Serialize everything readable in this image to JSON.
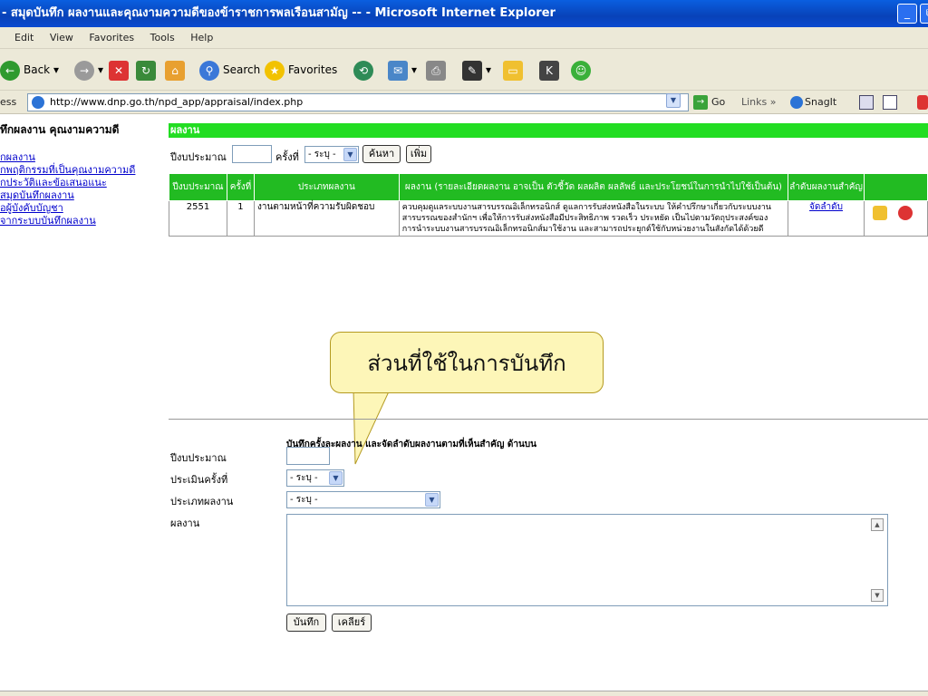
{
  "window": {
    "title": "- สมุดบันทึก ผลงานและคุณงามความดีของข้าราชการพลเรือนสามัญ -- - Microsoft Internet Explorer",
    "minimize": "_",
    "restore": "⧉"
  },
  "menu": [
    "Edit",
    "View",
    "Favorites",
    "Tools",
    "Help"
  ],
  "toolbar": {
    "back": "Back",
    "search": "Search",
    "favorites": "Favorites"
  },
  "address": {
    "label": "ess",
    "url": "http://www.dnp.go.th/npd_app/appraisal/index.php",
    "go": "Go",
    "links": "Links",
    "links_arrow": "»",
    "snagit": "SnagIt"
  },
  "sidebar": {
    "title": "ทึกผลงาน คุณงามความดี",
    "links": [
      "กผลงาน",
      "กพฤติกรรมที่เป็นคุณงามความดี",
      "กประวัติและข้อเสนอแนะ",
      "สมุดบันทึกผลงาน",
      "อผู้บังคับบัญชา",
      "จากระบบบันทึกผลงาน"
    ]
  },
  "section": {
    "title": "ผลงาน"
  },
  "search": {
    "year_label": "ปีงบประมาณ",
    "round_label": "ครั้งที่",
    "round_value": "- ระบุ -",
    "find_button": "ค้นหา",
    "add_button": "เพิ่ม"
  },
  "table": {
    "headers": [
      "ปีงบประมาณ",
      "ครั้งที่",
      "ประเภทผลงาน",
      "ผลงาน (รายละเอียดผลงาน อาจเป็น ตัวชี้วัด ผลผลิต ผลลัพธ์ และประโยชน์ในการนำไปใช้เป็นต้น)",
      "ลำดับผลงานสำคัญ",
      ""
    ],
    "rows": [
      {
        "year": "2551",
        "round": "1",
        "type": "งานตามหน้าที่ความรับผิดชอบ",
        "detail": "ควบคุมดูแลระบบงานสารบรรณอิเล็กทรอนิกส์ ดูแลการรับส่งหนังสือในระบบ ให้คำปรึกษาเกี่ยวกับระบบงานสารบรรณของสำนักฯ เพื่อให้การรับส่งหนังสือมีประสิทธิภาพ รวดเร็ว ประหยัด เป็นไปตามวัตถุประสงค์ของการนำระบบงานสารบรรณอิเล็กทรอนิกส์มาใช้งาน และสามารถประยุกต์ใช้กับหน่วยงานในสังกัดได้ด้วยดี",
        "rank": "จัดลำดับ"
      }
    ]
  },
  "callout": {
    "text": "ส่วนที่ใช้ในการบันทึก"
  },
  "form": {
    "heading": "บันทึกครั้งละผลงาน และจัดลำดับผลงานตามที่เห็นสำคัญ ด้านบน",
    "year_label": "ปีงบประมาณ",
    "round_label": "ประเมินครั้งที่",
    "round_value": "- ระบุ -",
    "type_label": "ประเภทผลงาน",
    "type_value": "- ระบุ -",
    "work_label": "ผลงาน",
    "save_button": "บันทึก",
    "clear_button": "เคลียร์"
  }
}
